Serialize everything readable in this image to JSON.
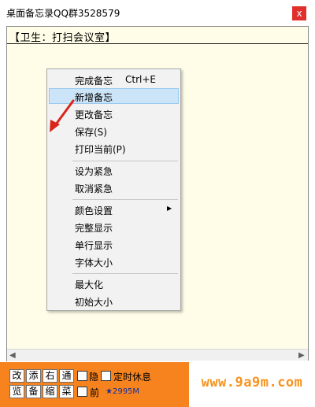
{
  "window": {
    "title": "桌面备忘录QQ群3528579",
    "close_label": "x"
  },
  "memo": {
    "text": "【卫生：打扫会议室】"
  },
  "context_menu": {
    "items": [
      {
        "label": "完成备忘",
        "shortcut": "Ctrl+E"
      },
      {
        "label": "新增备忘"
      },
      {
        "label": "更改备忘"
      },
      {
        "label": "保存(S)"
      },
      {
        "label": "打印当前(P)"
      },
      {
        "label": "设为紧急"
      },
      {
        "label": "取消紧急"
      },
      {
        "label": "颜色设置"
      },
      {
        "label": "完整显示"
      },
      {
        "label": "单行显示"
      },
      {
        "label": "字体大小"
      },
      {
        "label": "最大化"
      },
      {
        "label": "初始大小"
      }
    ],
    "highlighted": "新增备忘"
  },
  "toolbar": {
    "row1": [
      "改",
      "添",
      "右",
      "通"
    ],
    "row2": [
      "览",
      "备",
      "缩",
      "菜"
    ],
    "hide_label": "隐",
    "timed_rest_label": "定时休息",
    "front_label": "前",
    "memory_label": "★2995M"
  },
  "watermark": {
    "text": "www.9a9m.com"
  },
  "colors": {
    "toolbar_bg": "#f7831f",
    "memo_bg": "#fffde8",
    "close_bg": "#e0302c",
    "highlight": "#cce4f7",
    "watermark": "#f7931e"
  }
}
